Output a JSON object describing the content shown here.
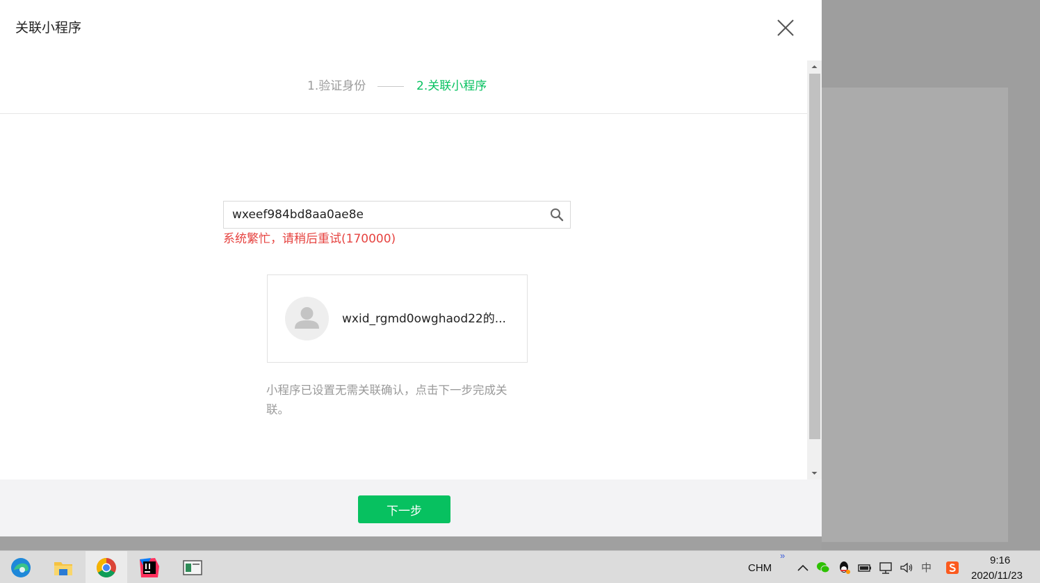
{
  "dialog": {
    "title": "关联小程序",
    "steps": [
      {
        "label": "1.验证身份",
        "state": "done",
        "color": "#9a9a9a"
      },
      {
        "label": "2.关联小程序",
        "state": "active",
        "color": "#07c160"
      }
    ]
  },
  "search": {
    "value": "wxeef984bd8aa0ae8e",
    "icon": "search-icon"
  },
  "error": {
    "text": "系统繁忙，请稍后重试(170000)",
    "color": "#e64340"
  },
  "app_card": {
    "name": "wxid_rgmd0owghaod22的...",
    "avatar_icon": "user-avatar-icon"
  },
  "hint": "小程序已设置无需关联确认，点击下一步完成关联。",
  "footer": {
    "next_label": "下一步",
    "accent": "#07c160"
  },
  "taskbar": {
    "apps": [
      {
        "name": "edge-icon"
      },
      {
        "name": "file-explorer-icon"
      },
      {
        "name": "chrome-icon",
        "active": true
      },
      {
        "name": "intellij-icon"
      },
      {
        "name": "app-window-icon"
      }
    ],
    "tray": {
      "ime_label": "CHM",
      "overflow": "»",
      "lang": "中"
    },
    "clock": {
      "time": "9:16",
      "date": "2020/11/23"
    }
  }
}
